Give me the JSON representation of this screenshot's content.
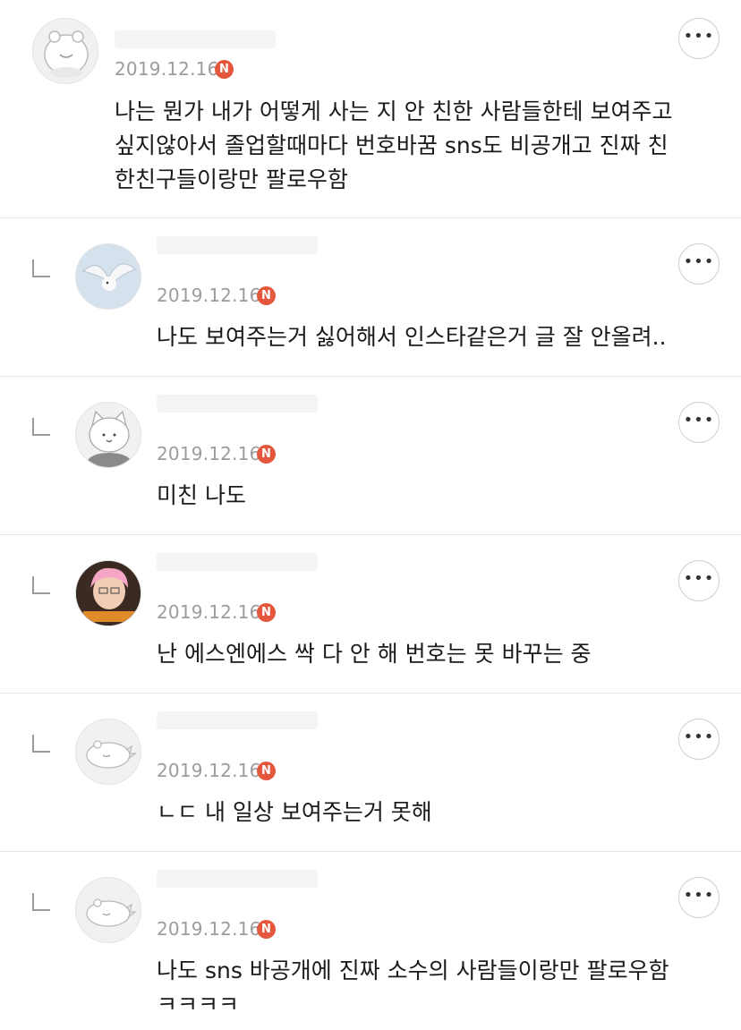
{
  "comments": [
    {
      "date": "2019.12.16",
      "badge": "N",
      "more": "•••",
      "text_lines": [
        "나는 뭔가 내가 어떻게 사는 지 안 친한 사람들한테 보여주고",
        "싶지않아서 졸업할때마다 번호바꿈 sns도 비공개고 진짜 친",
        "한친구들이랑만 팔로우함"
      ]
    },
    {
      "date": "2019.12.16",
      "badge": "N",
      "more": "•••",
      "text_lines": [
        "나도 보여주는거 싫어해서 인스타같은거 글 잘 안올려.."
      ]
    },
    {
      "date": "2019.12.16",
      "badge": "N",
      "more": "•••",
      "text_lines": [
        "미친 나도"
      ]
    },
    {
      "date": "2019.12.16",
      "badge": "N",
      "more": "•••",
      "text_lines": [
        "난 에스엔에스 싹 다 안 해 번호는 못 바꾸는 중"
      ]
    },
    {
      "date": "2019.12.16",
      "badge": "N",
      "more": "•••",
      "text_lines": [
        "ㄴㄷ 내 일상 보여주는거 못해"
      ]
    },
    {
      "date": "2019.12.16",
      "badge": "N",
      "more": "•••",
      "text_lines": [
        "나도 sns 바공개에 진짜 소수의 사람들이랑만 팔로우함",
        "ㅋㅋㅋㅋ"
      ]
    }
  ],
  "avatars": [
    "hamster-avatar",
    "bird-photo-avatar",
    "cat-avatar",
    "pink-hair-photo-avatar",
    "hamster-avatar",
    "hamster-avatar"
  ]
}
